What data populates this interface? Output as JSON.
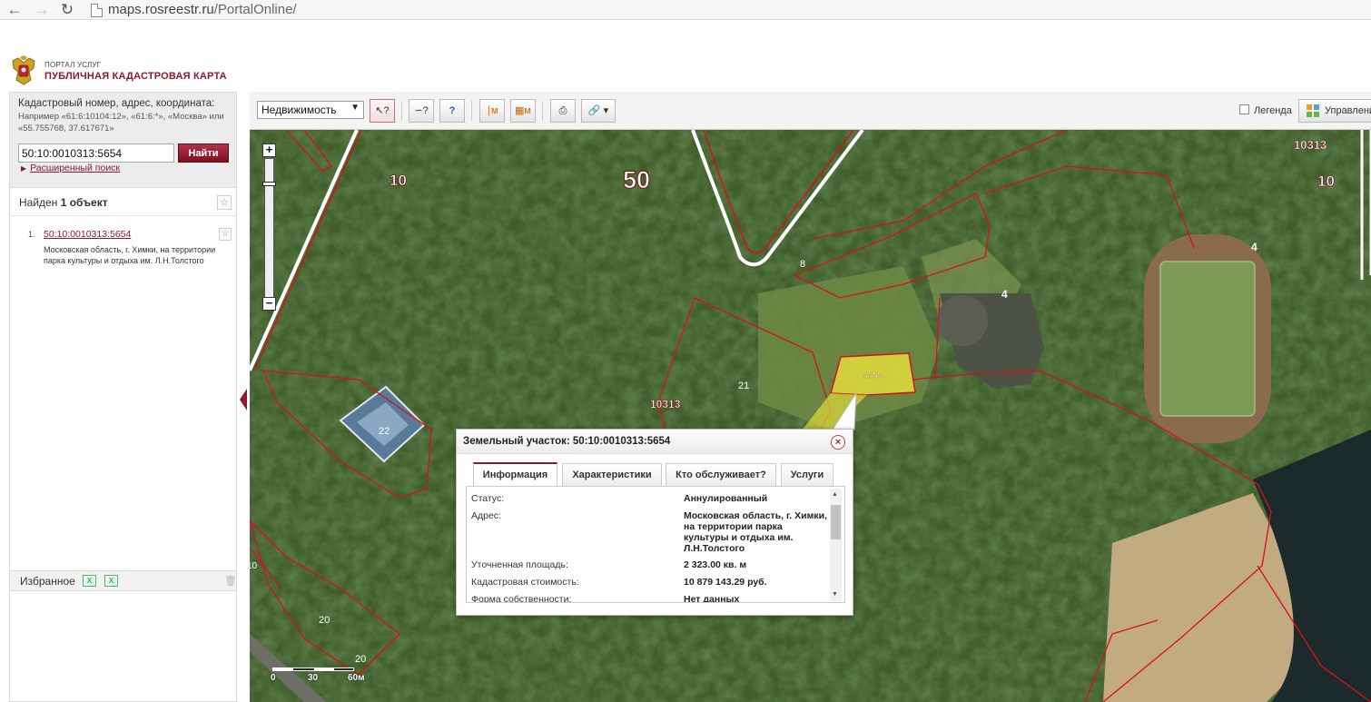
{
  "browser": {
    "url_host": "maps.rosreestr.ru",
    "url_path": "/PortalOnline/"
  },
  "header": {
    "portal_label": "ПОРТАЛ УСЛУГ",
    "portal_title": "ПУБЛИЧНАЯ КАДАСТРОВАЯ КАРТА"
  },
  "sidebar": {
    "search_hint": "Кадастровый номер, адрес, координата:",
    "search_example": "Например «61:6:10104:12», «61:6:*», «Москва» или «55.755768, 37.617671»",
    "search_value": "50:10:0010313:5654",
    "find_label": "Найти",
    "advanced_search": "Расширенный поиск",
    "found_prefix": "Найден",
    "found_count": "1 объект",
    "results": [
      {
        "num": "1.",
        "number": "50:10:0010313:5654",
        "address": "Московская область, г. Химки, на территории парка культуры и отдыха им. Л.Н.Толстого"
      }
    ],
    "favorites_title": "Избранное"
  },
  "toolbar": {
    "layer_value": "Недвижимость",
    "legend_label": "Легенда",
    "manage_label": "Управление"
  },
  "map": {
    "parcel_labels": [
      "10",
      "50",
      "10313",
      "10",
      "8",
      "4",
      "4",
      "5654",
      "21",
      "10313",
      "22",
      "20",
      "20",
      "10"
    ],
    "scale_labels": [
      "0",
      "30",
      "60м"
    ]
  },
  "popup": {
    "title": "Земельный участок: 50:10:0010313:5654",
    "tabs": [
      "Информация",
      "Характеристики",
      "Кто обслуживает?",
      "Услуги"
    ],
    "rows": [
      {
        "label": "Статус:",
        "value": "Аннулированный"
      },
      {
        "label": "Адрес:",
        "value": "Московская область, г. Химки, на территории парка культуры и отдыха им. Л.Н.Толстого"
      },
      {
        "label": "Уточненная площадь:",
        "value": "2 323.00 кв. м"
      },
      {
        "label": "Кадастровая стоимость:",
        "value": "10 879 143.29 руб."
      },
      {
        "label": "Форма собственности:",
        "value": "Нет данных"
      }
    ]
  },
  "colors": {
    "brand": "#8b1a2f",
    "parcel_border": "#d8101e",
    "selected_parcel": "#e8e23a"
  }
}
